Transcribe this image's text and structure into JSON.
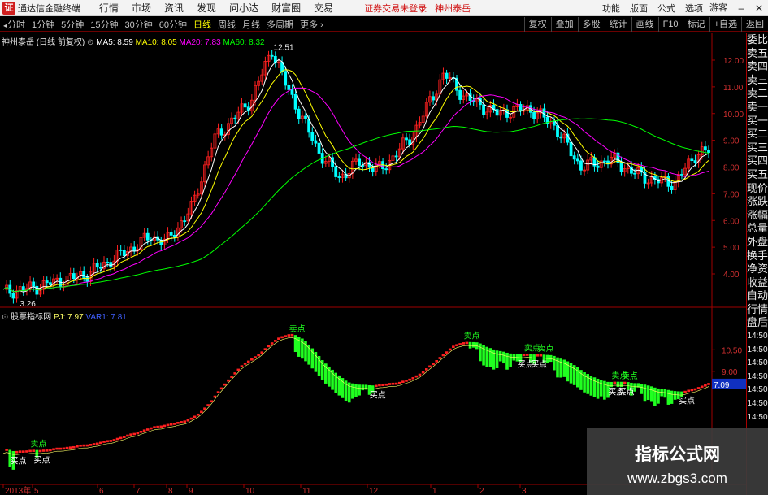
{
  "titlebar": {
    "app_title": "通达信金融终端",
    "logo": "证",
    "menus": [
      "行情",
      "市场",
      "资讯",
      "发现",
      "问小达",
      "财富圈",
      "交易"
    ],
    "warn1": "证券交易未登录",
    "warn2": "神州泰岳",
    "right_menus": [
      "功能",
      "版面",
      "公式",
      "选项"
    ],
    "login": "游客"
  },
  "toolbar": {
    "periods": [
      "分时",
      "1分钟",
      "5分钟",
      "15分钟",
      "30分钟",
      "60分钟",
      "日线",
      "周线",
      "月线",
      "多周期",
      "更多"
    ],
    "selected": "日线",
    "right_buttons": [
      "复权",
      "叠加",
      "多股",
      "统计",
      "画线",
      "F10",
      "标记",
      "+自选",
      "返回"
    ]
  },
  "upper": {
    "stock": "神州泰岳",
    "period_tag": "(日线 前复权)",
    "ma": [
      {
        "label": "MA5: 8.59",
        "color": "#ffffff"
      },
      {
        "label": "MA10: 8.05",
        "color": "#ffff00"
      },
      {
        "label": "MA20: 7.83",
        "color": "#ff00ff"
      },
      {
        "label": "MA60: 8.32",
        "color": "#00ff00"
      }
    ],
    "high_label": "12.51",
    "low_label": "3.26",
    "price_axis": [
      "12.00",
      "11.00",
      "10.00",
      "9.00",
      "8.00",
      "7.00",
      "6.00",
      "5.00",
      "4.00"
    ]
  },
  "lower": {
    "name": "股票指标网",
    "pj": "PJ: 7.97",
    "var1": "VAR1: 7.81",
    "price_axis": [
      "10.50",
      "9.00"
    ],
    "current_value": "7.09",
    "buy_label": "买点",
    "sell_label": "卖点"
  },
  "date_axis": [
    "2013年",
    "5",
    "6",
    "7",
    "8",
    "9",
    "10",
    "11",
    "12",
    "1",
    "2",
    "3"
  ],
  "side_panel": [
    "委比",
    "卖五",
    "卖四",
    "卖三",
    "卖二",
    "卖一",
    "买一",
    "买二",
    "买三",
    "买四",
    "买五",
    "现价",
    "涨跌",
    "涨幅",
    "总量",
    "外盘",
    "换手",
    "净资",
    "收益",
    "自动",
    "行情",
    "盘后",
    "14:50",
    "14:50",
    "14:50",
    "14:50",
    "14:50",
    "14:50",
    "14:50"
  ],
  "watermark": {
    "line1": "指标公式网",
    "line2": "www.zbgs3.com"
  },
  "colors": {
    "up": "#ff2020",
    "down": "#00ffff",
    "ma5": "#ffffff",
    "ma10": "#ffff00",
    "ma20": "#ff00ff",
    "ma60": "#00ff00",
    "ind_up": "#ff2020",
    "ind_down": "#20ff20",
    "grid_red": "#a00000"
  }
}
